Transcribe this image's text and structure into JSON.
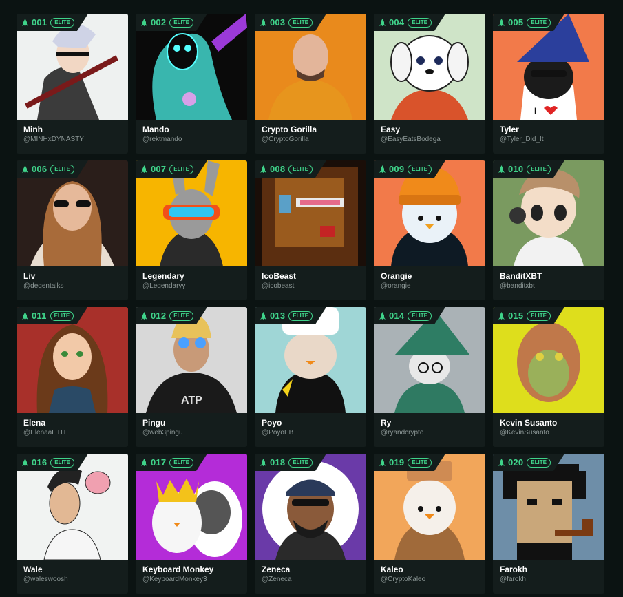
{
  "badge_label": "ELITE",
  "accent_color": "#3fd38a",
  "rank_icon": "rocket-icon",
  "cards": [
    {
      "rank": "001",
      "name": "Minh",
      "handle": "@MINHxDYNASTY",
      "bg": "#eef1f0",
      "art": "anime-swordsman"
    },
    {
      "rank": "002",
      "name": "Mando",
      "handle": "@rektmando",
      "bg": "#0a0a0a",
      "art": "neon-skeleton"
    },
    {
      "rank": "003",
      "name": "Crypto Gorilla",
      "handle": "@CryptoGorilla",
      "bg": "#e98a1c",
      "art": "man-orange-hoodie"
    },
    {
      "rank": "004",
      "name": "Easy",
      "handle": "@EasyEatsBodega",
      "bg": "#cfe4c8",
      "art": "white-dog"
    },
    {
      "rank": "005",
      "name": "Tyler",
      "handle": "@Tyler_Did_It",
      "bg": "#f27a4a",
      "art": "wizard-penguin"
    },
    {
      "rank": "006",
      "name": "Liv",
      "handle": "@degentalks",
      "bg": "#2a1e1a",
      "art": "woman-sunglasses"
    },
    {
      "rank": "007",
      "name": "Legendary",
      "handle": "@Legendaryy",
      "bg": "#f7b500",
      "art": "rabbit-visor"
    },
    {
      "rank": "008",
      "name": "IcoBeast",
      "handle": "@icobeast",
      "bg": "#1a0e08",
      "art": "pixel-beast"
    },
    {
      "rank": "009",
      "name": "Orangie",
      "handle": "@orangie",
      "bg": "#f27a4a",
      "art": "penguin-beanie"
    },
    {
      "rank": "010",
      "name": "BanditXBT",
      "handle": "@banditxbt",
      "bg": "#7a9a60",
      "art": "anime-boy-headphones"
    },
    {
      "rank": "011",
      "name": "Elena",
      "handle": "@ElenaaETH",
      "bg": "#a8302a",
      "art": "woman-long-hair"
    },
    {
      "rank": "012",
      "name": "Pingu",
      "handle": "@web3pingu",
      "bg": "#d8d8d8",
      "art": "glowing-eyes-hoodie"
    },
    {
      "rank": "013",
      "name": "Poyo",
      "handle": "@PoyoEB",
      "bg": "#9fd6d6",
      "art": "penguin-chef"
    },
    {
      "rank": "014",
      "name": "Ry",
      "handle": "@ryandcrypto",
      "bg": "#aab2b6",
      "art": "wizard-cat"
    },
    {
      "rank": "015",
      "name": "Kevin Susanto",
      "handle": "@KevinSusanto",
      "bg": "#dede1c",
      "art": "zombie-ape"
    },
    {
      "rank": "016",
      "name": "Wale",
      "handle": "@waleswoosh",
      "bg": "#f1f3f2",
      "art": "sketch-man"
    },
    {
      "rank": "017",
      "name": "Keyboard Monkey",
      "handle": "@KeyboardMonkey3",
      "bg": "#b42cd8",
      "art": "penguin-crown-gorilla"
    },
    {
      "rank": "018",
      "name": "Zeneca",
      "handle": "@Zeneca",
      "bg": "#6a3aa8",
      "art": "bandana-man"
    },
    {
      "rank": "019",
      "name": "Kaleo",
      "handle": "@CryptoKaleo",
      "bg": "#f2a65a",
      "art": "penguin-suit"
    },
    {
      "rank": "020",
      "name": "Farokh",
      "handle": "@farokh",
      "bg": "#6e8ea8",
      "art": "pixel-punk"
    }
  ]
}
